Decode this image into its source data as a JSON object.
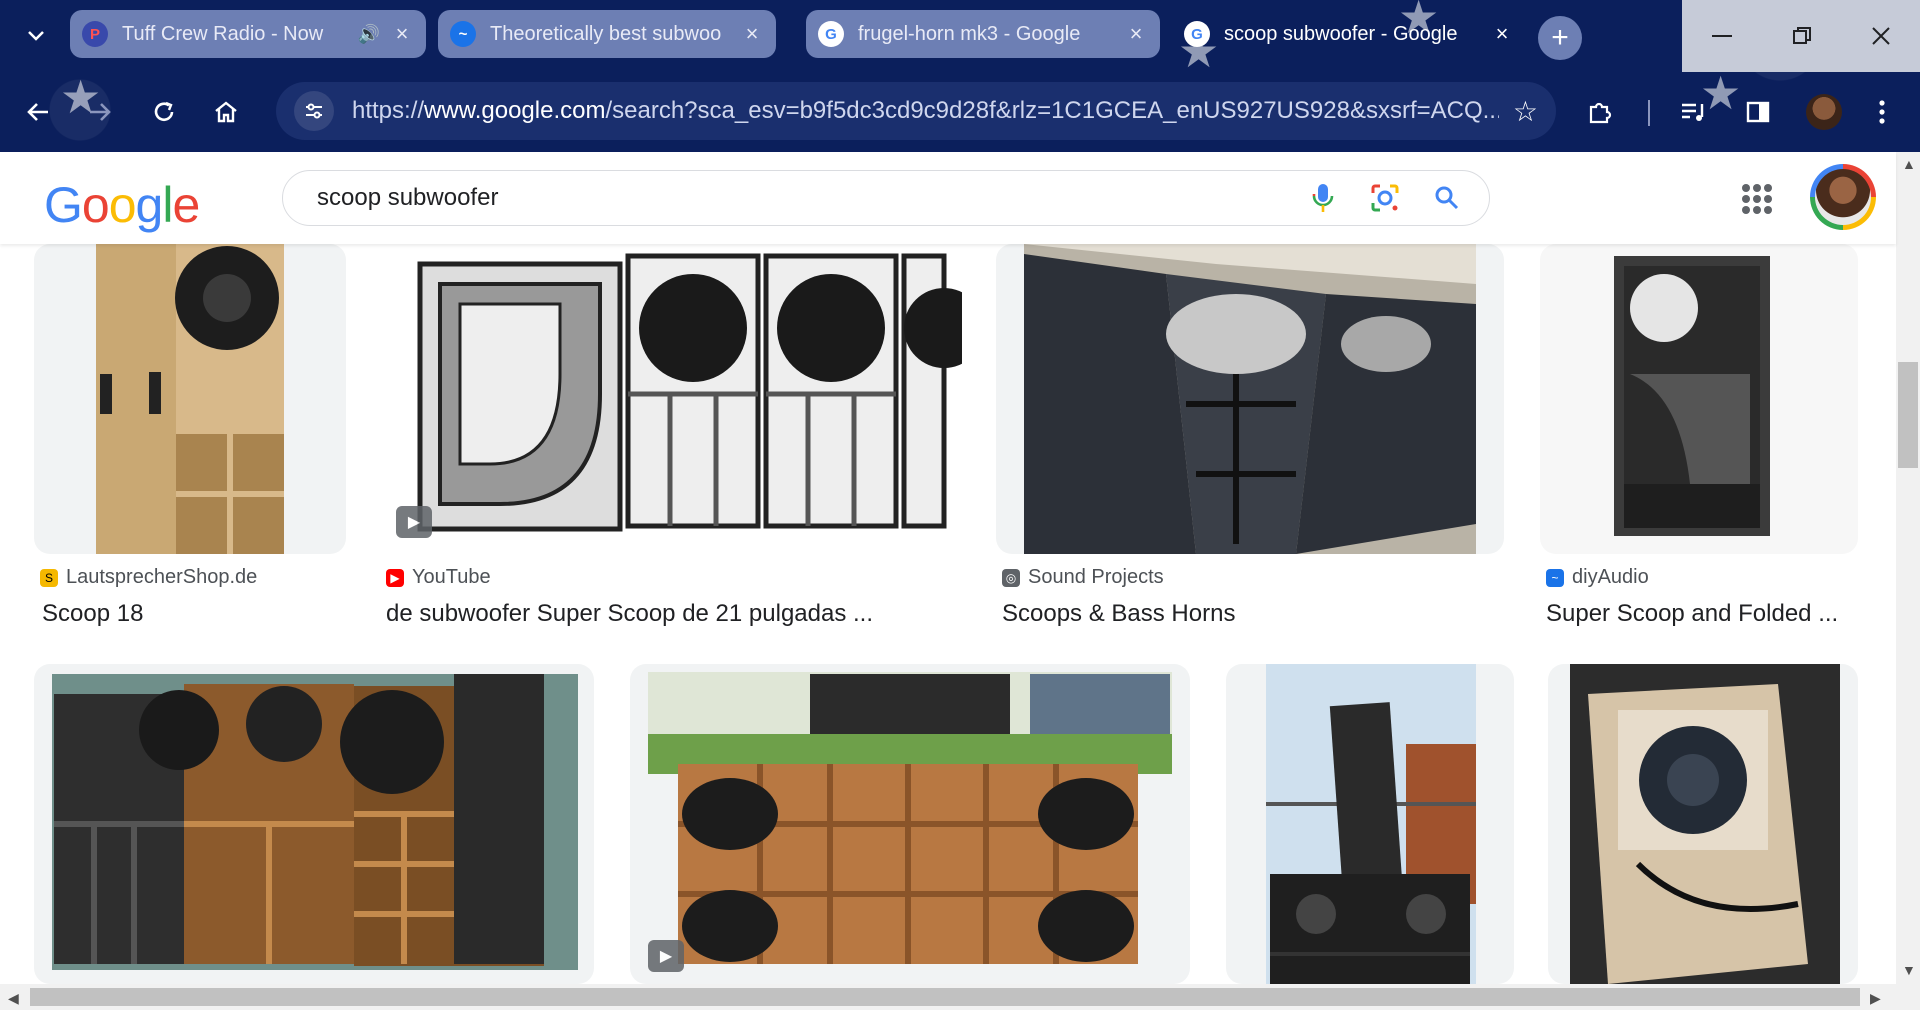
{
  "tabs": [
    {
      "title": "Tuff Crew Radio - Now",
      "favicon": "tuffcrew-favicon",
      "audio": true
    },
    {
      "title": "Theoretically best subwoo",
      "favicon": "diyaudio-favicon"
    },
    {
      "title": "frugel-horn mk3 - Google",
      "favicon": "google-favicon"
    },
    {
      "title": "scoop subwoofer - Google",
      "favicon": "google-favicon",
      "active": true
    }
  ],
  "omnibox": {
    "url_prefix": "https://",
    "url_domain": "www.google.com",
    "url_rest": "/search?sca_esv=b9f5dc3cd9c9d28f&rlz=1C1GCEA_enUS927US928&sxsrf=ACQ..."
  },
  "google": {
    "logo": [
      "G",
      "o",
      "o",
      "g",
      "l",
      "e"
    ],
    "query": "scoop subwoofer"
  },
  "results_row1": [
    {
      "source": "LautsprecherShop.de",
      "title": "Scoop 18",
      "favicon_color": "#f5b800"
    },
    {
      "source": "YouTube",
      "title": "de subwoofer Super Scoop de 21 pulgadas ...",
      "favicon_color": "#ff0000",
      "video": true
    },
    {
      "source": "Sound Projects",
      "title": "Scoops & Bass Horns",
      "favicon_color": "#5f6368"
    },
    {
      "source": "diyAudio",
      "title": "Super Scoop and Folded ...",
      "favicon_color": "#1a73e8"
    }
  ],
  "results_row2": [
    {
      "image": "three-scoop-cabinets"
    },
    {
      "image": "double-scoop-render",
      "video": true
    },
    {
      "image": "line-array-stack"
    },
    {
      "image": "single-scoop-cabinet"
    }
  ],
  "colors": {
    "chrome_bg": "#0b1f5c",
    "tab_inactive": "#6d7fb4",
    "google_blue": "#4285f4"
  }
}
